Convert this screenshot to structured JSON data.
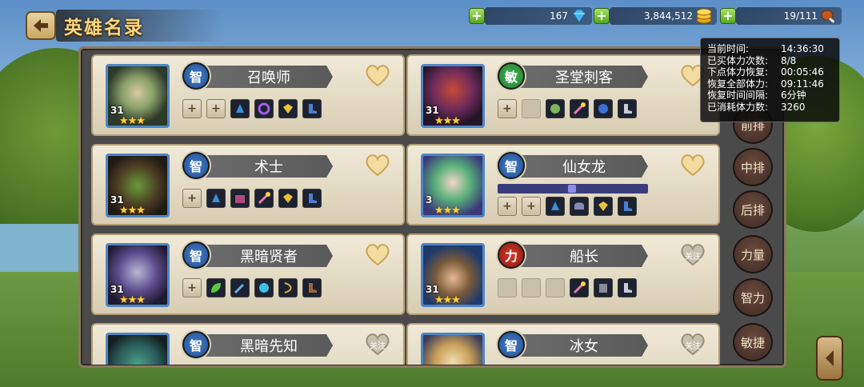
{
  "header": {
    "title": "英雄名录"
  },
  "resources": {
    "diamonds": "167",
    "gold": "3,844,512",
    "stamina": "19/111"
  },
  "stamina_tooltip": [
    {
      "label": "当前时间:",
      "value": "14:36:30"
    },
    {
      "label": "已买体力次数:",
      "value": "8/8"
    },
    {
      "label": "下点体力恢复:",
      "value": "00:05:46"
    },
    {
      "label": "恢复全部体力:",
      "value": "09:11:46"
    },
    {
      "label": "恢复时间间隔:",
      "value": "6分钟"
    },
    {
      "label": "已消耗体力数:",
      "value": "3260"
    }
  ],
  "heroes": [
    {
      "name": "召唤师",
      "attr": "智",
      "level": "31",
      "favorite_label": ""
    },
    {
      "name": "圣堂刺客",
      "attr": "敏",
      "level": "31",
      "favorite_label": ""
    },
    {
      "name": "术士",
      "attr": "智",
      "level": "31",
      "favorite_label": ""
    },
    {
      "name": "仙女龙",
      "attr": "智",
      "level": "3",
      "favorite_label": ""
    },
    {
      "name": "黑暗贤者",
      "attr": "智",
      "level": "31",
      "favorite_label": ""
    },
    {
      "name": "船长",
      "attr": "力",
      "level": "31",
      "favorite_label": "关注"
    },
    {
      "name": "黑暗先知",
      "attr": "智",
      "level": "",
      "favorite_label": "关注"
    },
    {
      "name": "冰女",
      "attr": "智",
      "level": "",
      "favorite_label": "关注"
    }
  ],
  "filters": [
    "前排",
    "中排",
    "后排",
    "力量",
    "智力",
    "敏捷"
  ],
  "colors": {
    "int": "#1e4f95",
    "agi": "#1e7d2e",
    "str": "#8a1a10"
  }
}
